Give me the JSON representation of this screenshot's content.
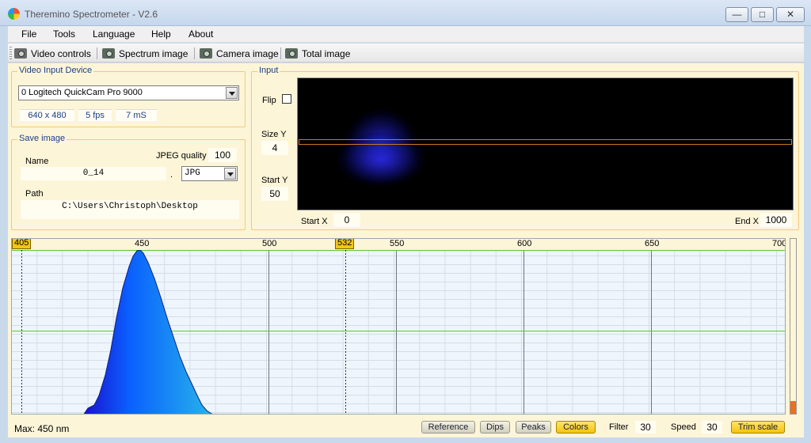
{
  "window": {
    "title": "Theremino Spectrometer - V2.6"
  },
  "menu": [
    "File",
    "Tools",
    "Language",
    "Help",
    "About"
  ],
  "toolbar": {
    "video_controls": "Video controls",
    "spectrum_image": "Spectrum image",
    "camera_image": "Camera image",
    "total_image": "Total image"
  },
  "video_device": {
    "title": "Video Input Device",
    "device": "0 Logitech QuickCam Pro 9000",
    "resolution": "640 x 480",
    "fps": "5 fps",
    "exposure": "7 mS"
  },
  "save_image": {
    "title": "Save image",
    "name_label": "Name",
    "name_value": "0_14",
    "dot": ".",
    "jpeg_quality_label": "JPEG quality",
    "jpeg_quality_value": "100",
    "format": "JPG",
    "path_label": "Path",
    "path_value": "C:\\Users\\Christoph\\Desktop"
  },
  "input": {
    "title": "Input",
    "flip_label": "Flip",
    "size_y_label": "Size Y",
    "size_y_value": "4",
    "start_y_label": "Start Y",
    "start_y_value": "50",
    "start_x_label": "Start X",
    "start_x_value": "0",
    "end_x_label": "End X",
    "end_x_value": "1000"
  },
  "spectrum": {
    "marker_left": "405",
    "marker_mid": "532",
    "scale": [
      "450",
      "500",
      "550",
      "600",
      "650",
      "700"
    ],
    "peak_nm": 450,
    "gradient_colors": [
      "#1a10d0",
      "#0a60ff",
      "#28b8e8"
    ]
  },
  "status": {
    "max_text": "Max: 450 nm",
    "reference": "Reference",
    "dips": "Dips",
    "peaks": "Peaks",
    "colors": "Colors",
    "filter_label": "Filter",
    "filter_value": "30",
    "speed_label": "Speed",
    "speed_value": "30",
    "trim_scale": "Trim scale"
  }
}
